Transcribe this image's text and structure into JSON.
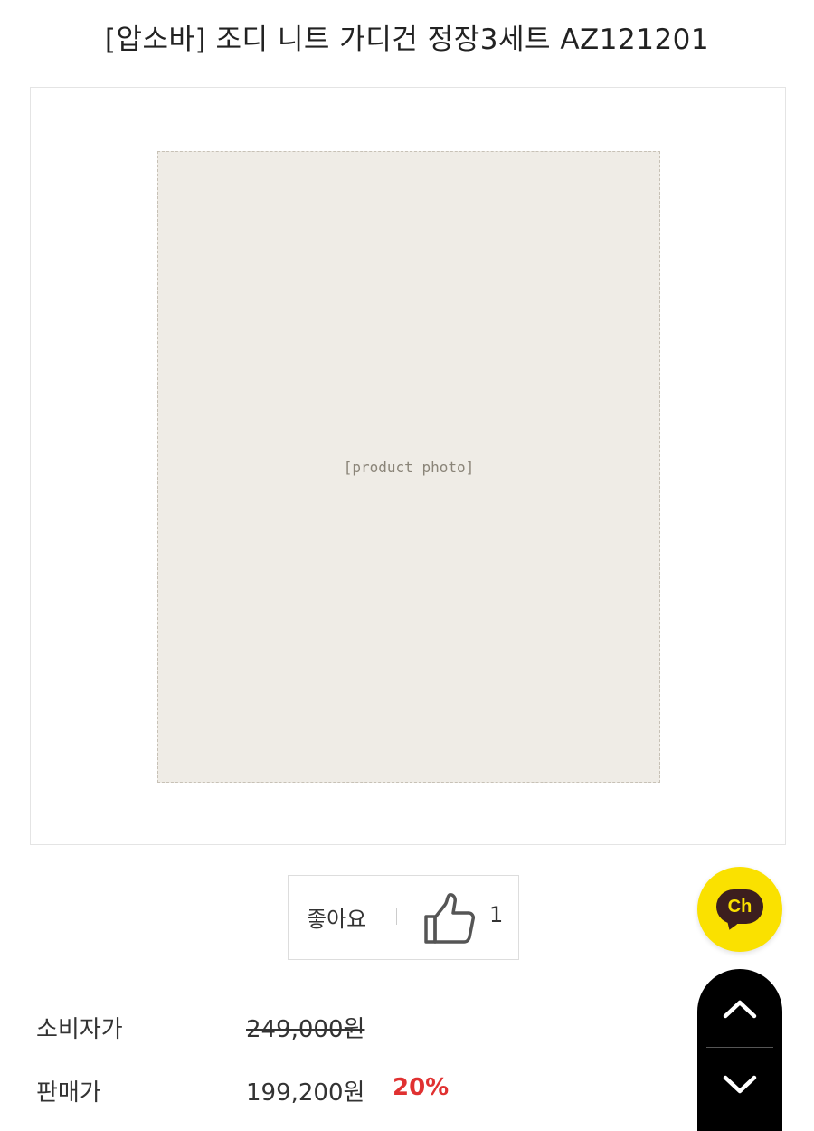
{
  "product": {
    "title": "[압소바] 조디 니트 가디건 정장3세트 AZ121201",
    "image": {
      "placeholder": "[product photo]"
    }
  },
  "like": {
    "label": "좋아요",
    "icon": "thumbs-up-icon",
    "count": "1"
  },
  "price": {
    "consumer_label": "소비자가",
    "consumer_value": "249,000원",
    "sale_label": "판매가",
    "sale_value": "199,200원",
    "discount": "20%"
  },
  "floating": {
    "channel_label": "Ch",
    "channel_icon": "kakao-channel-icon",
    "up_icon": "chevron-up-icon",
    "down_icon": "chevron-down-icon"
  },
  "colors": {
    "channel_yellow": "#fae100",
    "channel_brown": "#3c1e1e",
    "discount_red": "#e03131",
    "scroll_bg": "#000000"
  }
}
